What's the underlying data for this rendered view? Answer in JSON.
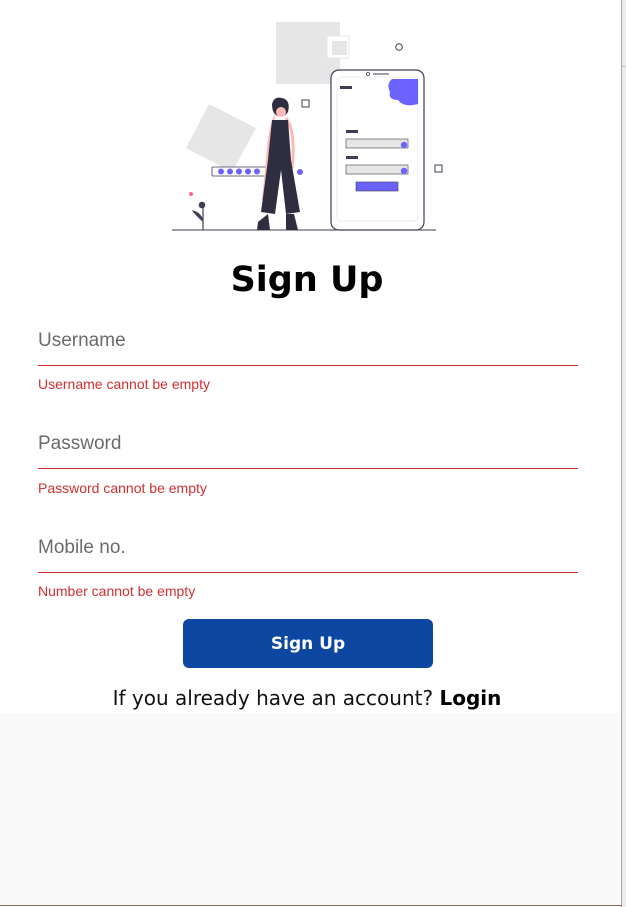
{
  "form": {
    "title": "Sign Up",
    "fields": [
      {
        "placeholder": "Username",
        "value": "",
        "error": "Username cannot be empty"
      },
      {
        "placeholder": "Password",
        "value": "",
        "error": "Password cannot be empty"
      },
      {
        "placeholder": "Mobile no.",
        "value": "",
        "error": "Number cannot be empty"
      }
    ],
    "submit_label": "Sign Up",
    "login_prompt": "If you already have an account?",
    "login_link": "Login"
  },
  "colors": {
    "primary_button": "#0d47a1",
    "error": "#d32f2f",
    "illustration_accent": "#6c63ff"
  },
  "illustration": {
    "icon": "signup-illustration"
  }
}
